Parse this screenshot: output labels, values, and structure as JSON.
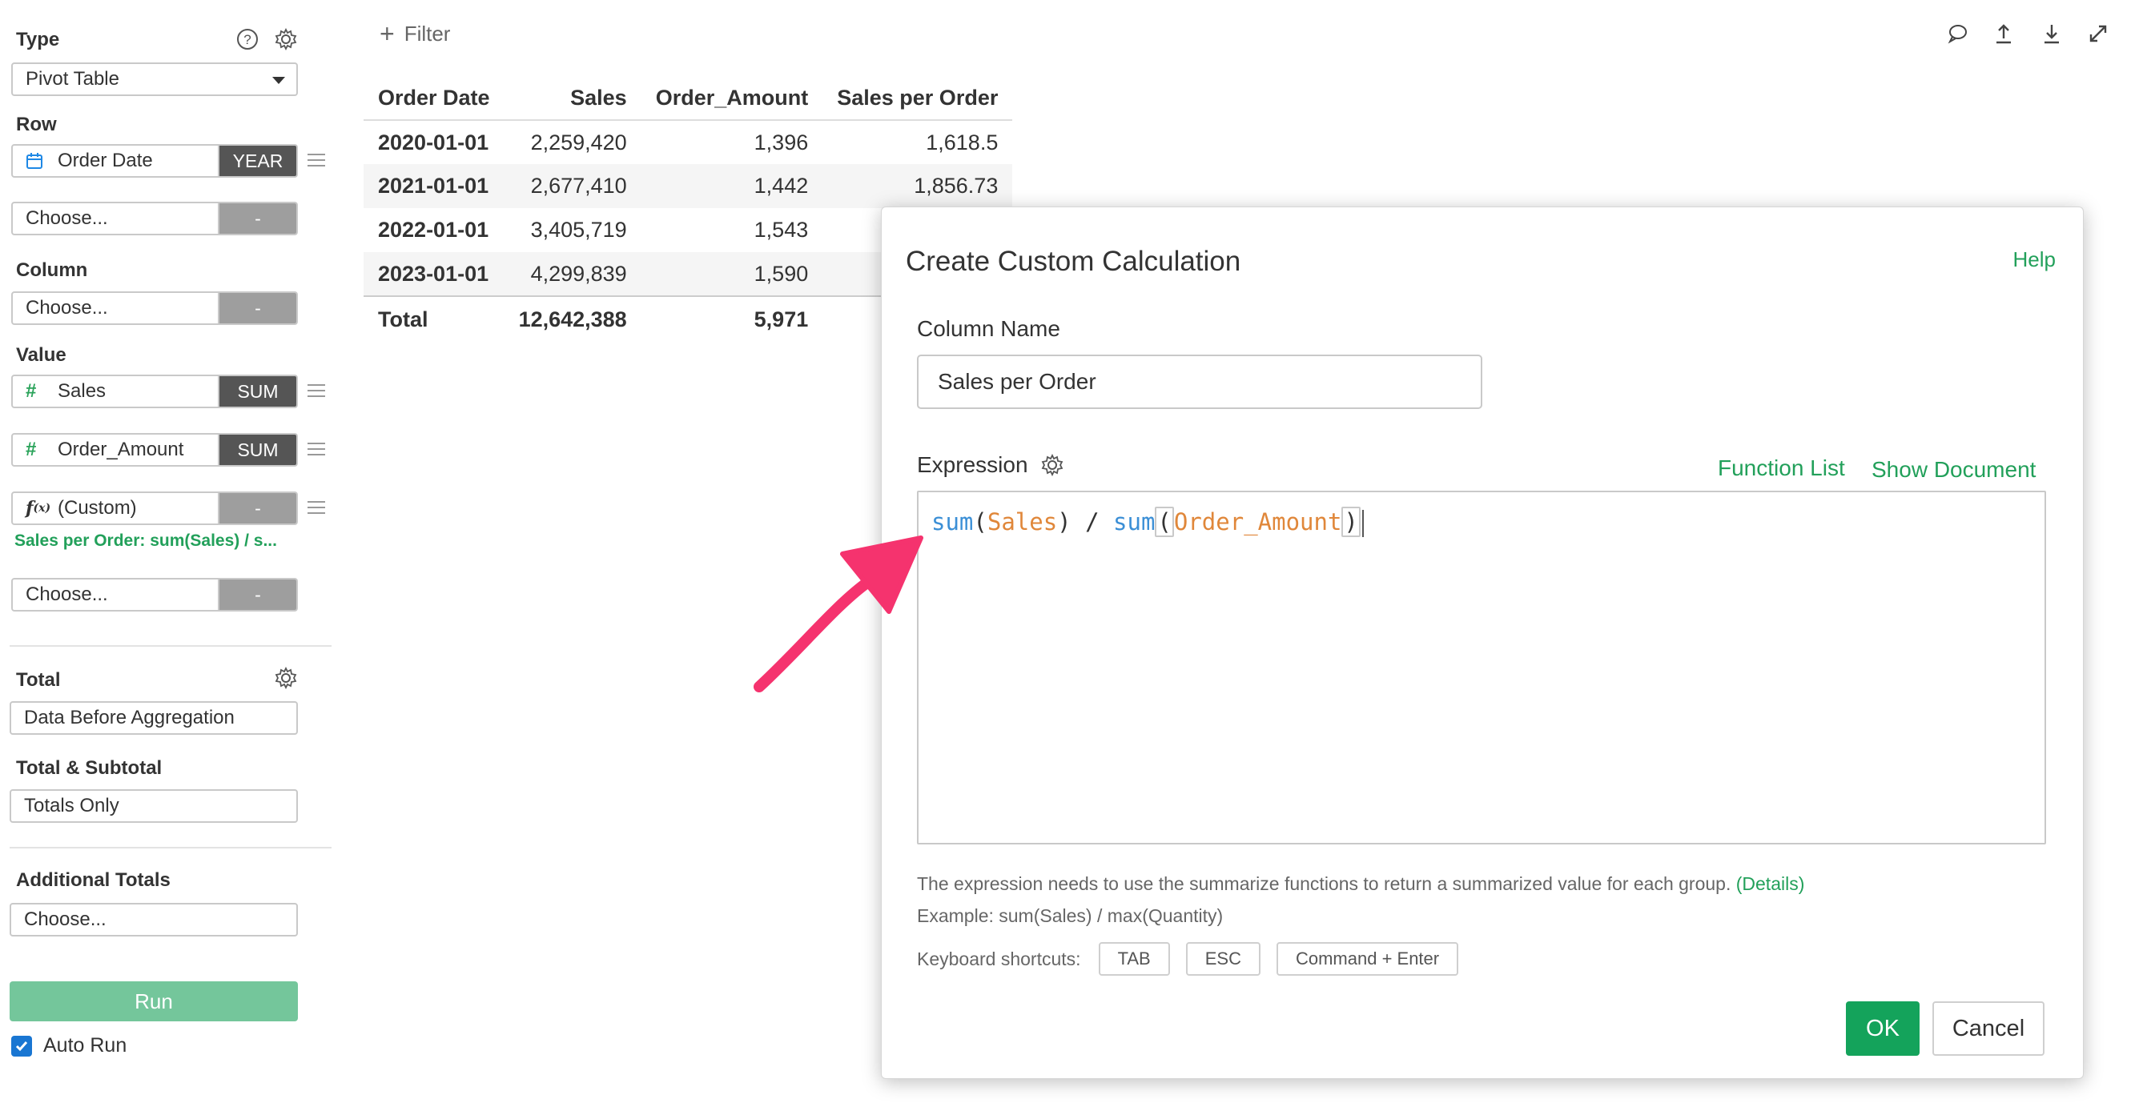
{
  "sidebar": {
    "type": {
      "label": "Type",
      "selected": "Pivot Table"
    },
    "row": {
      "label": "Row",
      "fields": [
        {
          "name": "Order Date",
          "icon": "calendar-icon",
          "agg": "YEAR"
        },
        {
          "name": "Choose...",
          "agg": "-"
        }
      ]
    },
    "column": {
      "label": "Column",
      "fields": [
        {
          "name": "Choose...",
          "agg": "-"
        }
      ]
    },
    "value": {
      "label": "Value",
      "fields": [
        {
          "name": "Sales",
          "icon": "hash-icon",
          "agg": "SUM"
        },
        {
          "name": "Order_Amount",
          "icon": "hash-icon",
          "agg": "SUM"
        },
        {
          "name": "(Custom)",
          "icon": "function-icon",
          "agg": "-"
        },
        {
          "name": "Choose...",
          "agg": "-"
        }
      ],
      "custom_note": "Sales per Order: sum(Sales) / s..."
    },
    "total": {
      "label": "Total",
      "value": "Data Before Aggregation"
    },
    "total_subtotal": {
      "label": "Total & Subtotal",
      "value": "Totals Only"
    },
    "additional_totals": {
      "label": "Additional Totals",
      "value": "Choose..."
    },
    "run_label": "Run",
    "auto_run": {
      "label": "Auto Run",
      "checked": true
    }
  },
  "toolbar": {
    "filter_label": "Filter"
  },
  "pivot": {
    "headers": [
      "Order Date",
      "Sales",
      "Order_Amount",
      "Sales per Order"
    ],
    "rows": [
      [
        "2020-01-01",
        "2,259,420",
        "1,396",
        "1,618.5"
      ],
      [
        "2021-01-01",
        "2,677,410",
        "1,442",
        "1,856.73"
      ],
      [
        "2022-01-01",
        "3,405,719",
        "1,543",
        ""
      ],
      [
        "2023-01-01",
        "4,299,839",
        "1,590",
        ""
      ]
    ],
    "total": [
      "Total",
      "12,642,388",
      "5,971",
      ""
    ]
  },
  "dialog": {
    "title": "Create Custom Calculation",
    "help": "Help",
    "column_name_label": "Column Name",
    "column_name_value": "Sales per Order",
    "expression_label": "Expression",
    "function_list": "Function List",
    "show_document": "Show Document",
    "expression": {
      "fn1": "sum",
      "open1": "(",
      "arg1": "Sales",
      "close1": ")",
      "op": " / ",
      "fn2": "sum",
      "open2": "(",
      "arg2": "Order_Amount",
      "close2": ")"
    },
    "hint_text": "The expression needs to use the summarize functions to return a summarized value for each group.",
    "hint_details": "(Details)",
    "example": "Example: sum(Sales) / max(Quantity)",
    "shortcuts_label": "Keyboard shortcuts:",
    "shortcuts": [
      "TAB",
      "ESC",
      "Command + Enter"
    ],
    "ok": "OK",
    "cancel": "Cancel"
  },
  "colors": {
    "accent": "#22a05a",
    "ok": "#14a35b",
    "run": "#74c69b",
    "arrow": "#f5336e",
    "fn": "#3b8fd6",
    "col": "#e0873a"
  }
}
